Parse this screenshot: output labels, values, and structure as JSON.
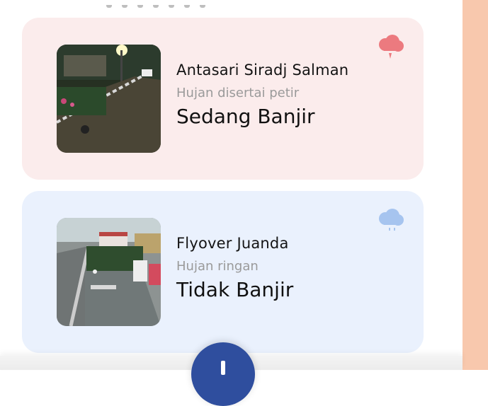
{
  "cards": [
    {
      "location": "Antasari Siradj Salman",
      "weather": "Hujan disertai petir",
      "status": "Sedang Banjir",
      "icon": "storm-cloud-icon",
      "accent": "#ec7a7f",
      "background": "#fbecec"
    },
    {
      "location": "Flyover Juanda",
      "weather": "Hujan ringan",
      "status": "Tidak Banjir",
      "icon": "rain-cloud-icon",
      "accent": "#a6c4ef",
      "background": "#eaf1fd"
    }
  ],
  "fab": {
    "icon": "plus-icon",
    "color": "#2f4e9e"
  }
}
